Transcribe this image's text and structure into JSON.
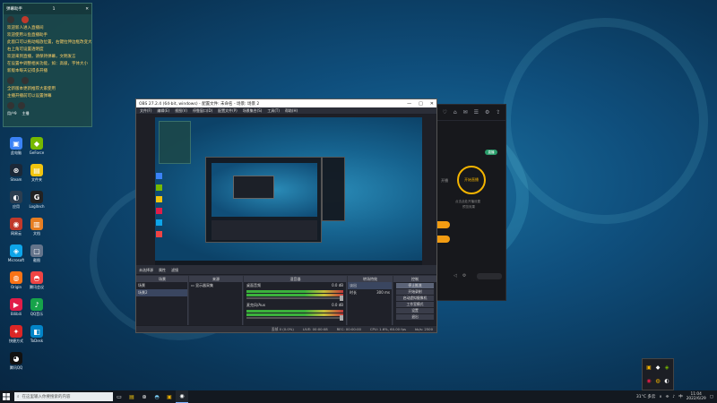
{
  "chat": {
    "title": "弹幕助手",
    "count": "1",
    "messages": [
      "欢迎新人进入直播间",
      "欢迎使用斗鱼直播助手",
      "此窗口可以拖动缩放位置，右键拉伸边框改变大小",
      "右上角可设置透明度",
      "欢迎来到直播，请保持弹幕，文明发言",
      "在设置中调整相关功能，如：高级，字体大小",
      "新版本每天记得多开播",
      "全新版本更新推荐大家使用",
      "主播开播前可以设置弹幕"
    ],
    "user": "用户9",
    "user2": "主播"
  },
  "desktop_icons": [
    {
      "label": "此电脑",
      "glyph": "▣",
      "color": "#3b82f6"
    },
    {
      "label": "GeForce",
      "glyph": "◆",
      "color": "#76b900"
    },
    {
      "label": "Steam",
      "glyph": "⊛",
      "color": "#1b2838"
    },
    {
      "label": "文件夹",
      "glyph": "▤",
      "color": "#f1c40f"
    },
    {
      "label": "应用",
      "glyph": "◐",
      "color": "#2c3e50"
    },
    {
      "label": "Logitech",
      "glyph": "G",
      "color": "#222"
    },
    {
      "label": "网易云",
      "glyph": "◉",
      "color": "#c0392b"
    },
    {
      "label": "文档",
      "glyph": "▥",
      "color": "#e67e22"
    },
    {
      "label": "Microsoft",
      "glyph": "◈",
      "color": "#0ea5e9"
    },
    {
      "label": "截图",
      "glyph": "▢",
      "color": "#64748b"
    },
    {
      "label": "Origin",
      "glyph": "◍",
      "color": "#f97316"
    },
    {
      "label": "腾讯会议",
      "glyph": "◓",
      "color": "#ef4444"
    },
    {
      "label": "Bilibili",
      "glyph": "▶",
      "color": "#e11d48"
    },
    {
      "label": "QQ音乐",
      "glyph": "♪",
      "color": "#16a34a"
    },
    {
      "label": "快捷方式",
      "glyph": "✦",
      "color": "#dc2626"
    },
    {
      "label": "ToDesk",
      "glyph": "◧",
      "color": "#0284c7"
    },
    {
      "label": "腾讯QQ",
      "glyph": "◕",
      "color": "#111"
    }
  ],
  "obs": {
    "title": "OBS 27.2.4 (64-bit, windows) - 配置文件: 未命名 - 场景: 场景 2",
    "menus": [
      "文件(F)",
      "编辑(E)",
      "视图(V)",
      "停靠窗口(D)",
      "配置文件(P)",
      "场景集合(S)",
      "工具(T)",
      "帮助(H)"
    ],
    "source_bar": [
      "未选择源",
      "属性",
      "滤镜"
    ],
    "docks": {
      "scenes": {
        "title": "场景",
        "items": [
          "场景",
          "场景2"
        ]
      },
      "sources": {
        "title": "来源",
        "items": [
          "显示器采集"
        ]
      },
      "mixer": {
        "title": "混音器",
        "tracks": [
          {
            "name": "桌面音频",
            "value": "0.0 dB"
          },
          {
            "name": "麦克风/Aux",
            "value": "0.0 dB"
          }
        ]
      },
      "transitions": {
        "title": "转场特效",
        "type": "淡出",
        "duration_label": "时长",
        "duration": "300 ms"
      },
      "controls": {
        "title": "控制",
        "buttons": [
          "停止推流",
          "开始录制",
          "启动虚拟摄像机",
          "工作室模式",
          "设置",
          "退出"
        ]
      }
    },
    "status": [
      "丢帧 0 (0.0%)",
      "LIVE: 00:00:08",
      "REC: 00:00:00",
      "CPU: 1.6%, 60.00 fps",
      "kb/s: 2500"
    ]
  },
  "stream_app": {
    "toolbar_icons": [
      "♡",
      "⌂",
      "✉",
      "☰",
      "⚙",
      "⇪"
    ],
    "badge": "直播",
    "ring_label": "开始直播",
    "side_left": "开播",
    "caption1": "点击此处开播设置",
    "caption2": "预览效果"
  },
  "taskbar": {
    "search_placeholder": "在这里输入你要搜索的内容",
    "temperature": "31°C 多云",
    "time": "11:04",
    "date": "2022/6/29"
  },
  "colors": {
    "accent": "#f4b400",
    "obs_bg": "#2b2e38",
    "taskbar": "#14181e"
  }
}
